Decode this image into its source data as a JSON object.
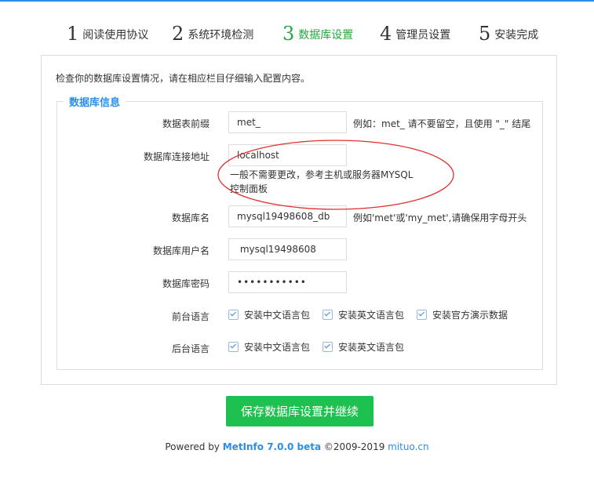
{
  "steps": [
    {
      "num": "1",
      "label": "阅读使用协议"
    },
    {
      "num": "2",
      "label": "系统环境检测"
    },
    {
      "num": "3",
      "label": "数据库设置"
    },
    {
      "num": "4",
      "label": "管理员设置"
    },
    {
      "num": "5",
      "label": "安装完成"
    }
  ],
  "colors": {
    "accent": "#2a8ee8",
    "active_step": "#21a93d",
    "button": "#1ec14f",
    "annotation": "#e03030"
  },
  "intro": "检查你的数据库设置情况，请在相应栏目仔细输入配置内容。",
  "legend": "数据库信息",
  "fields": {
    "prefix": {
      "label": "数据表前缀",
      "value": "met_",
      "hint": "例如：met_ 请不要留空，且使用 \"_\" 结尾"
    },
    "host": {
      "label": "数据库连接地址",
      "value": "localhost",
      "hint_line1": "一般不需要更改，参考主机或服务器MYSQL",
      "hint_line2": "控制面板"
    },
    "name": {
      "label": "数据库名",
      "value": "mysql19498608_db",
      "hint": "例如'met'或'my_met',请确保用字母开头"
    },
    "user": {
      "label": "数据库用户名",
      "value": " mysql19498608"
    },
    "password": {
      "label": "数据库密码",
      "value": "•••••••••••"
    }
  },
  "front_lang": {
    "label": "前台语言",
    "options": [
      {
        "label": "安装中文语言包",
        "checked": true
      },
      {
        "label": "安装英文语言包",
        "checked": true
      },
      {
        "label": "安装官方演示数据",
        "checked": true
      }
    ]
  },
  "back_lang": {
    "label": "后台语言",
    "options": [
      {
        "label": "安装中文语言包",
        "checked": true
      },
      {
        "label": "安装英文语言包",
        "checked": true
      }
    ]
  },
  "submit_label": "保存数据库设置并继续",
  "footer": {
    "prefix": "Powered by ",
    "brand": "MetInfo 7.0.0 beta",
    "copyright": " ©2009-2019 ",
    "site": "mituo.cn"
  }
}
